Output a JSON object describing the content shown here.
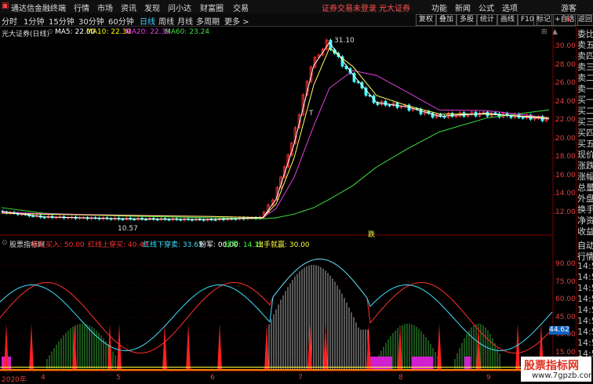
{
  "menubar": {
    "app_title": "通达信金融终端",
    "menus": [
      "行情",
      "市场",
      "资讯",
      "发现",
      "问小达",
      "财富圈",
      "交易"
    ],
    "notice": "证券交易未登录  光大证券",
    "right_menus": [
      "功能",
      "新闻",
      "公式",
      "选项"
    ],
    "guest": "游客"
  },
  "toolbar": {
    "periods": [
      "分时",
      "1分钟",
      "15分钟",
      "30分钟",
      "60分钟",
      "日线",
      "周线",
      "月线",
      "多周期",
      "更多 >"
    ],
    "active_period": "日线",
    "right_buttons": [
      "复权",
      "叠加",
      "多股",
      "统计",
      "画线",
      "F10",
      "标记",
      "+自选",
      "返回"
    ]
  },
  "stock": {
    "name": "光大证券(日线)"
  },
  "ma": [
    {
      "label": "MA5:",
      "value": "22.00",
      "color": "#ffffff"
    },
    {
      "label": "MA10:",
      "value": "22.30",
      "color": "#ffff00"
    },
    {
      "label": "MA20:",
      "value": "22.39",
      "color": "#e040e0"
    },
    {
      "label": "MA60:",
      "value": "23.24",
      "color": "#40e040"
    }
  ],
  "annotations": {
    "high": "31.10",
    "low": "10.57",
    "t_marker": "T",
    "sell_marker": "跌"
  },
  "price_axis": [
    "30.00",
    "28.00",
    "26.00",
    "24.00",
    "22.00",
    "20.00",
    "18.00",
    "16.00",
    "14.00",
    "12.00"
  ],
  "indicator": {
    "title": "股票指标网",
    "items": [
      {
        "label": "彩虹买入:",
        "value": "50.00",
        "color": "#ff3030"
      },
      {
        "label": "红线上穿买:",
        "value": "40.47",
        "color": "#ff3030"
      },
      {
        "label": "红线下穿卖:",
        "value": "33.65",
        "color": "#40e0ff"
      },
      {
        "label": "粉军:",
        "value": "00.00",
        "color": "#ffffff"
      },
      {
        "label": "绿军:",
        "value": "14.12",
        "color": "#40ff40"
      },
      {
        "label": "出手就赢:",
        "value": "30.00",
        "color": "#ffff40"
      }
    ]
  },
  "indicator_axis": [
    "90.00",
    "75.00",
    "60.00",
    "45.00",
    "30.00",
    "15.00"
  ],
  "current_indicator_value": "44.62",
  "date_axis": [
    "2020年",
    "4",
    "5",
    "6",
    "7",
    "8",
    "9"
  ],
  "right_panel": [
    "委比",
    "卖五",
    "卖四",
    "卖三",
    "卖二",
    "卖一",
    "买一",
    "买二",
    "买三",
    "买四",
    "买五",
    "现价",
    "涨跌",
    "涨幅",
    "总量",
    "外盘",
    "换手",
    "净资",
    "收益"
  ],
  "right_panel_lower": [
    "自动",
    "行情",
    "14:5",
    "14:5",
    "14:5",
    "14:5",
    "14:5",
    "14:5",
    "14:5",
    "14:5",
    "14:5"
  ],
  "watermark": {
    "title": "股票指标网",
    "url": "www.7gpzb.com"
  },
  "chart_data": {
    "type": "line",
    "price_series": {
      "x": [
        "2020-03",
        "2020-04",
        "2020-05",
        "2020-06",
        "2020-07-01",
        "2020-07-03",
        "2020-07-06",
        "2020-07-08",
        "2020-07-10",
        "2020-07-15",
        "2020-07-20",
        "2020-08",
        "2020-08-20",
        "2020-09",
        "2020-09-20"
      ],
      "close": [
        12.2,
        11.6,
        11.4,
        11.3,
        11.5,
        13.5,
        19.5,
        28.0,
        30.5,
        27.0,
        24.0,
        23.5,
        22.5,
        22.8,
        22.2
      ]
    },
    "ma60": [
      12.6,
      12.0,
      11.7,
      11.5,
      11.4,
      11.5,
      11.9,
      12.6,
      13.5,
      15.0,
      17.0,
      19.0,
      20.8,
      22.3,
      23.2
    ],
    "indicator_ylim": [
      0,
      100
    ]
  }
}
